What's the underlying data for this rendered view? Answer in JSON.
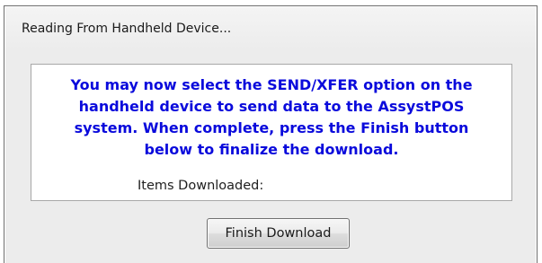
{
  "window": {
    "title": "Reading From Handheld Device..."
  },
  "content": {
    "message_lines": [
      "You may now select the SEND/XFER option on the",
      "handheld device to send data to the AssystPOS",
      "system. When complete, press the Finish button",
      "below to finalize the download."
    ],
    "items_downloaded_label": "Items Downloaded:",
    "items_downloaded_value": ""
  },
  "buttons": {
    "finish_label": "Finish Download"
  },
  "colors": {
    "message_text": "#0a0adc",
    "client_background": "#ececec"
  }
}
